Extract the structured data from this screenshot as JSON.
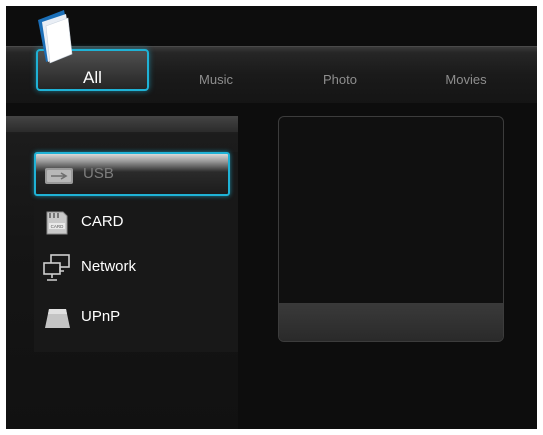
{
  "tabs": [
    {
      "label": "All",
      "active": true
    },
    {
      "label": "Music",
      "active": false
    },
    {
      "label": "Photo",
      "active": false
    },
    {
      "label": "Movies",
      "active": false
    }
  ],
  "sources": [
    {
      "label": "USB",
      "icon": "usb-icon",
      "selected": true
    },
    {
      "label": "CARD",
      "icon": "card-icon",
      "selected": false
    },
    {
      "label": "Network",
      "icon": "network-icon",
      "selected": false
    },
    {
      "label": "UPnP",
      "icon": "upnp-icon",
      "selected": false
    }
  ],
  "colors": {
    "accent": "#1fb2d6",
    "background": "#0d0d0d",
    "tab_inactive_text": "#8e8e8e"
  }
}
